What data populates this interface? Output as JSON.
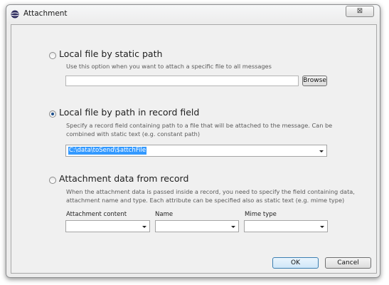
{
  "window": {
    "title": "Attachment",
    "close_glyph": "⊠",
    "app_icon": "java-icon"
  },
  "static_path": {
    "label": "Local file by static path",
    "selected": false,
    "description": "Use this option when you want to attach a specific file to all messages",
    "path_value": "",
    "browse_label": "Browse"
  },
  "record_field": {
    "label": "Local file by path in record field",
    "selected": true,
    "description_line1": "Specify a record field containing path to a file that will be attached to the message. Can be",
    "description_line2": "combined with static text (e.g. constant path)",
    "selected_value": "C:\\data\\toSend\\$attchFile"
  },
  "attachment_data": {
    "label": "Attachment data from record",
    "selected": false,
    "description_line1": "When the attachment data is passed inside a record, you need to specify the field containing data,",
    "description_line2": "attachment name and type. Each attribute can be specified also as static text (e.g. mime type)",
    "columns": {
      "content_label": "Attachment content",
      "name_label": "Name",
      "mime_label": "Mime type"
    }
  },
  "buttons": {
    "ok_label": "OK",
    "cancel_label": "Cancel"
  },
  "colors": {
    "selection": "#3399ff",
    "ok_border": "#3c7fb1",
    "ok_fill": "#dcecfc"
  }
}
